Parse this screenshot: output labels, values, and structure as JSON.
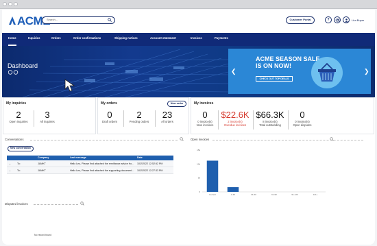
{
  "app": {
    "logo_text": "ACME"
  },
  "header": {
    "search_placeholder": "Search...",
    "customer_portal": "Customer Portal",
    "help_icon": "?",
    "username": "Lira Buyer"
  },
  "nav": {
    "items": [
      {
        "label": "Home",
        "active": true
      },
      {
        "label": "Inquiries"
      },
      {
        "label": "Orders"
      },
      {
        "label": "Order confirmations"
      },
      {
        "label": "Shipping notices"
      },
      {
        "label": "Account statement"
      },
      {
        "label": "Invoices"
      },
      {
        "label": "Payments"
      }
    ]
  },
  "hero": {
    "title": "Dashboard",
    "promo": {
      "line1": "ACME SEASON SALE",
      "line2": "IS ON NOW!",
      "button": "CHECK OUT TOP DEALS"
    }
  },
  "inquiries": {
    "title": "My inquiries",
    "stats": [
      {
        "value": "2",
        "label": "Open inquiries"
      },
      {
        "value": "3",
        "label": "All inquiries"
      }
    ]
  },
  "orders": {
    "title": "My orders",
    "new_button": "New order",
    "stats": [
      {
        "value": "0",
        "label": "Draft orders"
      },
      {
        "value": "2",
        "label": "Pending orders"
      },
      {
        "value": "23",
        "label": "All orders"
      }
    ]
  },
  "invoices": {
    "title": "My invoices",
    "stats": [
      {
        "value": "0",
        "label1": "0 invoice(s)",
        "label2": "New invoices"
      },
      {
        "value": "$22.6K",
        "label1": "2 invoice(s)",
        "label2": "Overdue invoices",
        "color": "#d63b2f"
      },
      {
        "value": "$66.3K",
        "label1": "8 invoice(s)",
        "label2": "Total outstanding"
      },
      {
        "value": "0",
        "label1": "0 invoice(s)",
        "label2": "Open disputes"
      }
    ]
  },
  "conversations": {
    "title": "Conversations",
    "new_button": "New conversation",
    "columns": [
      "Company",
      "Last message",
      "Date"
    ],
    "rows": [
      {
        "to": "To:",
        "company": "JAMKT",
        "message": "Hello Leo, Please find attached the remittance advice fro...",
        "date": "10/2/2022 12:52:52 PM"
      },
      {
        "to": "To:",
        "company": "JAMKT",
        "message": "Hello Leo, Please find attached the supporting document...",
        "date": "10/2/2022 12:27:33 PM"
      }
    ]
  },
  "open_invoices": {
    "title": "Open invoices"
  },
  "disputed_invoices": {
    "title": "Disputed invoices",
    "empty": "No record found"
  },
  "chart_data": {
    "type": "bar",
    "categories": [
      "Current",
      "1-30",
      "31-60",
      "61-90",
      "91-120",
      "121+"
    ],
    "values": [
      11.2,
      1.7,
      0,
      0,
      0,
      0
    ],
    "y_ticks": [
      "15k",
      "10k",
      "5k",
      "0"
    ],
    "ylim": [
      0,
      15
    ],
    "colors": {
      "bar": "#1f5fae"
    }
  }
}
